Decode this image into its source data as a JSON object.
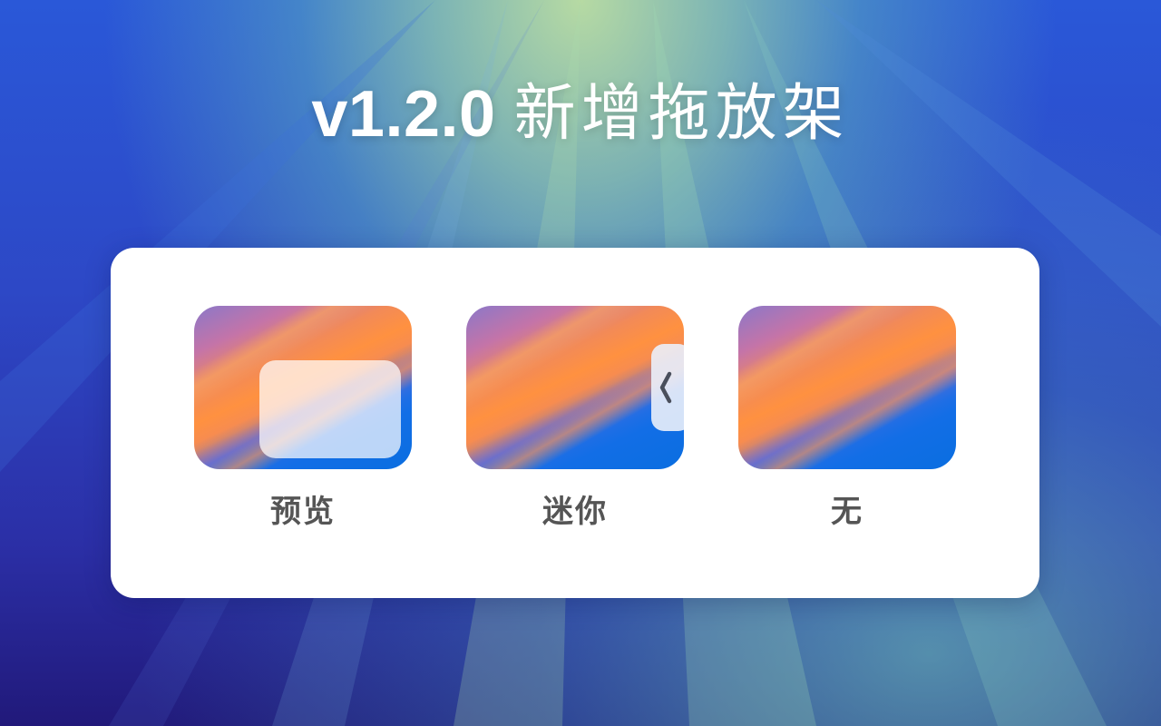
{
  "headline": {
    "version": "v1.2.0",
    "text": "新增拖放架"
  },
  "options": [
    {
      "label": "预览",
      "icon": "preview-card-icon"
    },
    {
      "label": "迷你",
      "icon": "chevron-left-icon"
    },
    {
      "label": "无",
      "icon": ""
    }
  ],
  "colors": {
    "panel": "#ffffff",
    "label": "#555555",
    "headline": "#ffffff"
  }
}
